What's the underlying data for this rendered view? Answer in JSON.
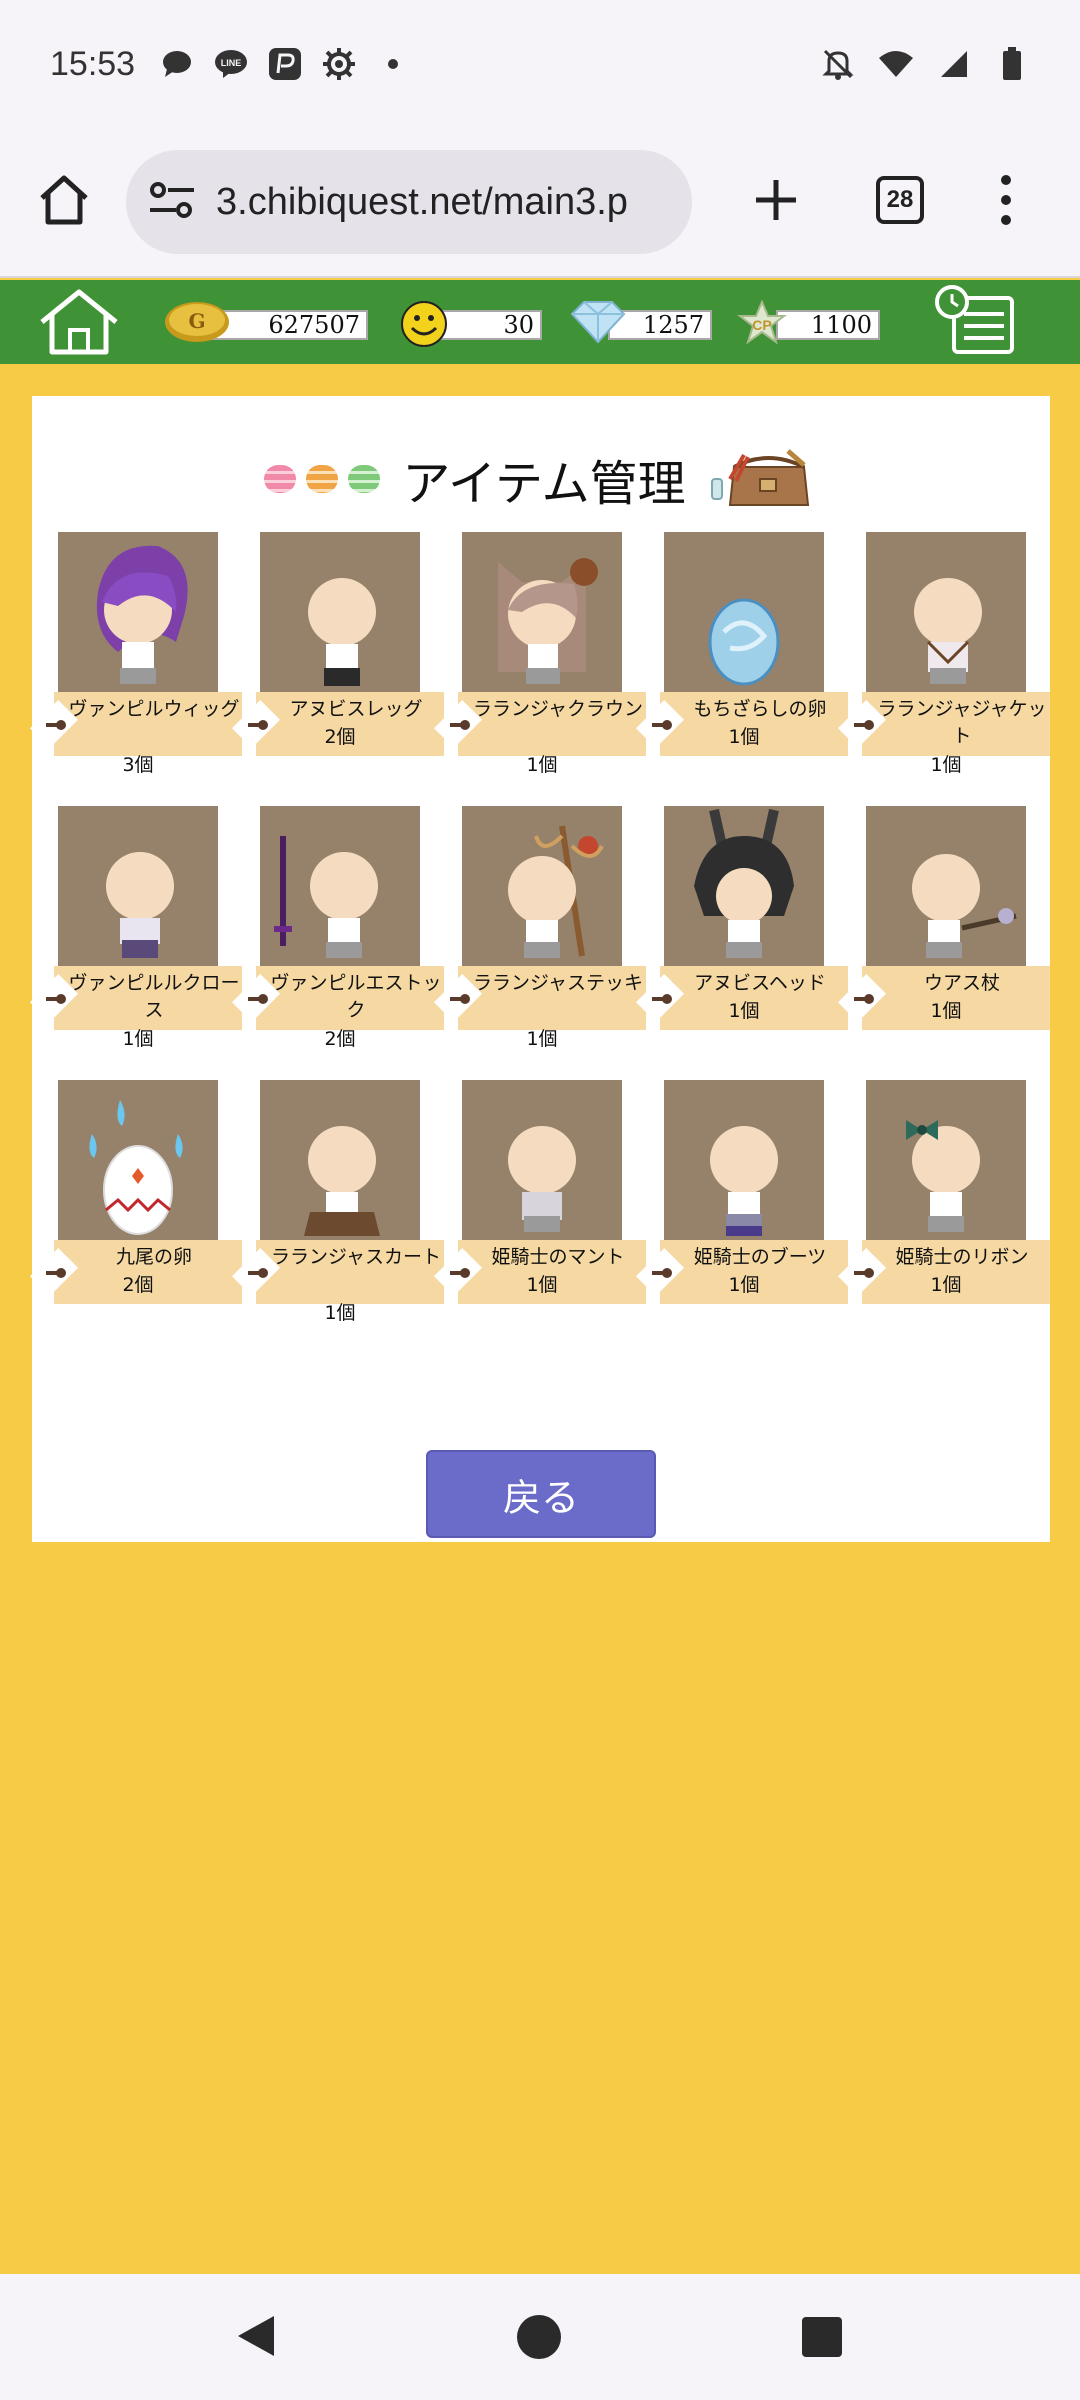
{
  "status_bar": {
    "time": "15:53"
  },
  "browser": {
    "url": "3.chibiquest.net/main3.p",
    "tab_count": "28"
  },
  "game_bar": {
    "gold": "627507",
    "smile": "30",
    "diamond": "1257",
    "cp": "1100",
    "cp_label": "CP"
  },
  "page": {
    "title": "アイテム管理"
  },
  "items": [
    {
      "name": "ヴァンピルウィッグ",
      "count": "3個"
    },
    {
      "name": "アヌビスレッグ",
      "count": "2個"
    },
    {
      "name": "ラランジャクラウン",
      "count": "1個"
    },
    {
      "name": "もちざらしの卵",
      "count": "1個"
    },
    {
      "name": "ラランジャジャケット",
      "count": "1個"
    },
    {
      "name": "ヴァンピルルクロース",
      "count": "1個"
    },
    {
      "name": "ヴァンピルエストック",
      "count": "2個"
    },
    {
      "name": "ラランジャステッキ",
      "count": "1個"
    },
    {
      "name": "アヌビスヘッド",
      "count": "1個"
    },
    {
      "name": "ウアス杖",
      "count": "1個"
    },
    {
      "name": "九尾の卵",
      "count": "2個"
    },
    {
      "name": "ラランジャスカート",
      "count": "1個"
    },
    {
      "name": "姫騎士のマント",
      "count": "1個"
    },
    {
      "name": "姫騎士のブーツ",
      "count": "1個"
    },
    {
      "name": "姫騎士のリボン",
      "count": "1個"
    }
  ],
  "back_label": "戻る",
  "colors": {
    "game_bar": "#3f9236",
    "background": "#f7cb45",
    "button": "#6b6bc9",
    "tag": "#f5d8a2",
    "thumb": "#96826a"
  }
}
